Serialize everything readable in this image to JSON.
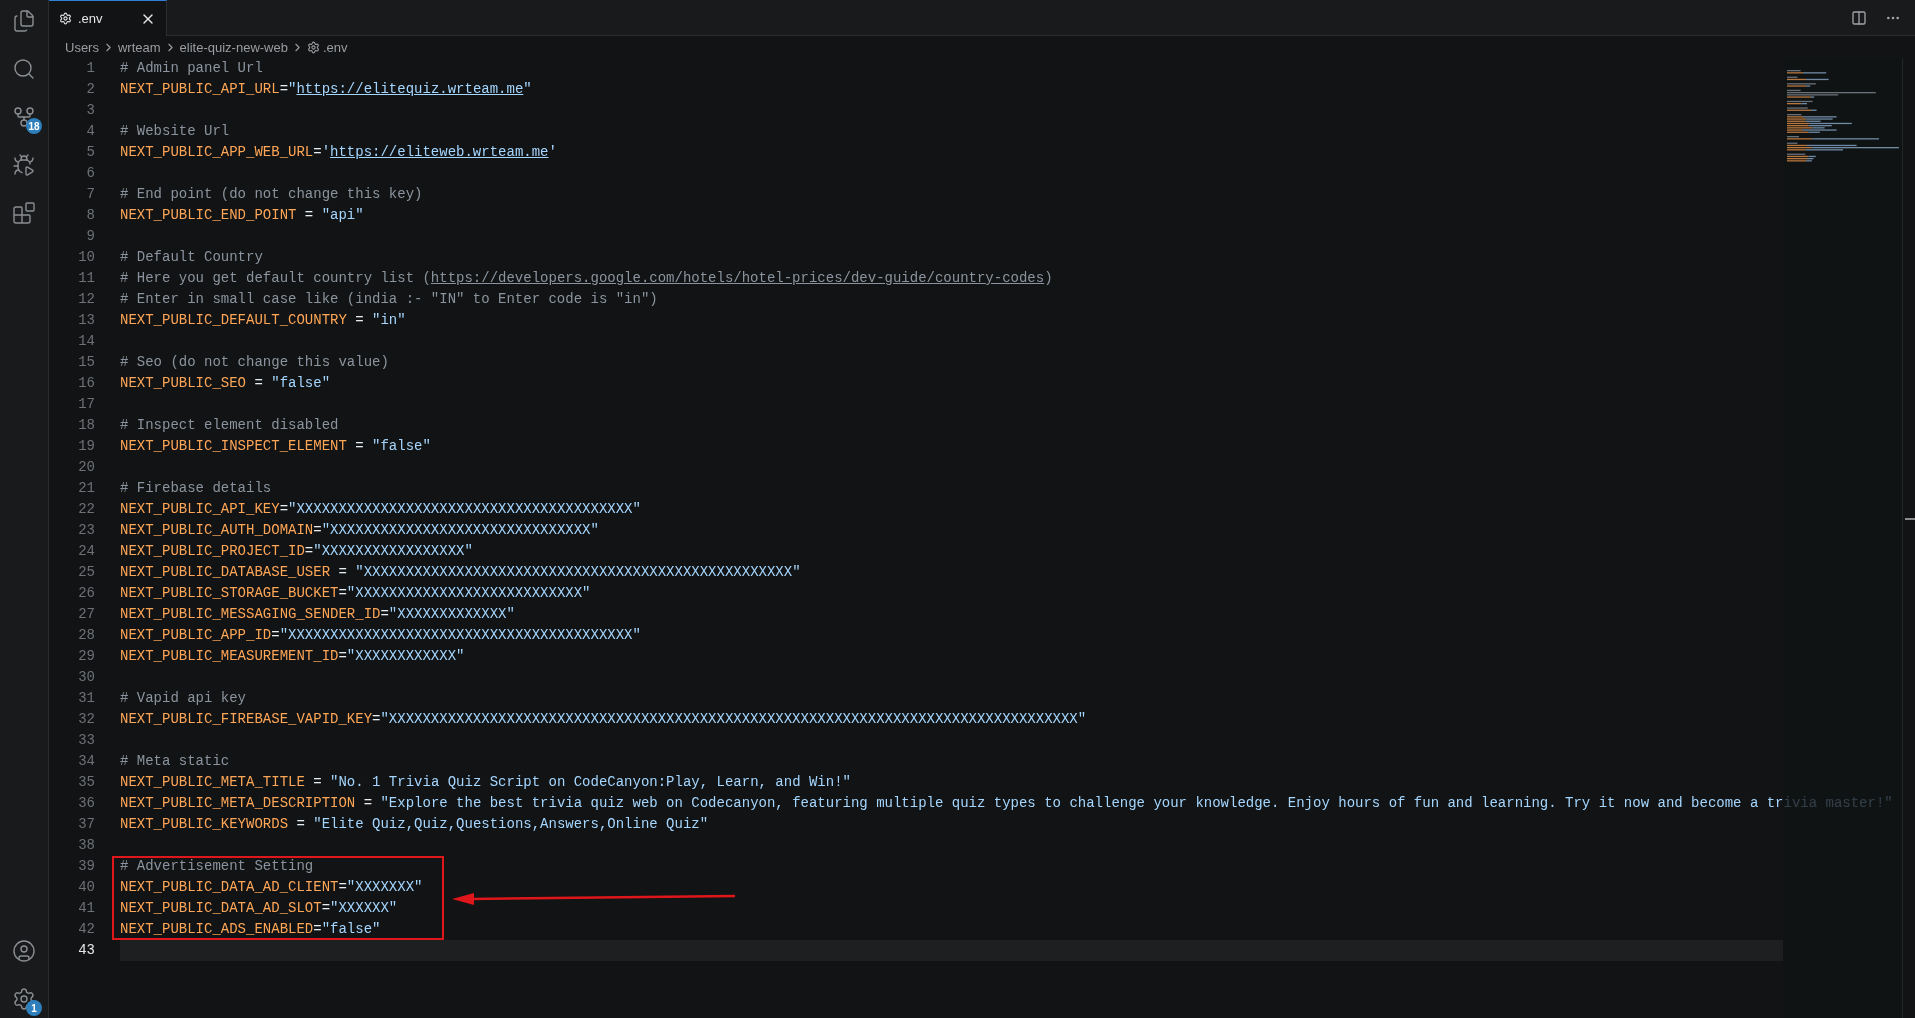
{
  "tab": {
    "label": ".env",
    "selected": true
  },
  "breadcrumbs": [
    "Users",
    "wrteam",
    "elite-quiz-new-web",
    ".env"
  ],
  "activity_bar": {
    "top": [
      {
        "kind": "explorer"
      },
      {
        "kind": "search"
      },
      {
        "kind": "source-control",
        "badge": "18"
      },
      {
        "kind": "run-debug"
      },
      {
        "kind": "extensions"
      }
    ],
    "bottom": [
      {
        "kind": "account"
      },
      {
        "kind": "settings",
        "badge": "1"
      }
    ]
  },
  "editor": {
    "lines": [
      {
        "number": "1",
        "kind": "comment",
        "text": "# Admin panel Url",
        "current": false,
        "boxed": false
      },
      {
        "number": "2",
        "kind": "assignment",
        "key": "NEXT_PUBLIC_API_URL",
        "sep": "=",
        "quote": "\"",
        "link": "https://elitequiz.wrteam.me",
        "current": false,
        "boxed": false
      },
      {
        "number": "3",
        "kind": "blank",
        "current": false,
        "boxed": false
      },
      {
        "number": "4",
        "kind": "comment",
        "text": "# Website Url",
        "current": false,
        "boxed": false
      },
      {
        "number": "5",
        "kind": "assignment",
        "key": "NEXT_PUBLIC_APP_WEB_URL",
        "sep": "=",
        "quote": "'",
        "link": "https://eliteweb.wrteam.me",
        "current": false,
        "boxed": false
      },
      {
        "number": "6",
        "kind": "blank",
        "current": false,
        "boxed": false
      },
      {
        "number": "7",
        "kind": "comment",
        "text": "# End point (do not change this key)",
        "current": false,
        "boxed": false
      },
      {
        "number": "8",
        "kind": "assignment",
        "key": "NEXT_PUBLIC_END_POINT",
        "sep": " = ",
        "value": "\"api\"",
        "current": false,
        "boxed": false
      },
      {
        "number": "9",
        "kind": "blank",
        "current": false,
        "boxed": false
      },
      {
        "number": "10",
        "kind": "comment",
        "text": "# Default Country",
        "current": false,
        "boxed": false
      },
      {
        "number": "11",
        "kind": "comment",
        "text": "# Here you get default country list (",
        "link": "https://developers.google.com/hotels/hotel-prices/dev-guide/country-codes",
        "after": ")",
        "current": false,
        "boxed": false
      },
      {
        "number": "12",
        "kind": "comment",
        "text": "# Enter in small case like (india :- \"IN\" to Enter code is \"in\")",
        "current": false,
        "boxed": false
      },
      {
        "number": "13",
        "kind": "assignment",
        "key": "NEXT_PUBLIC_DEFAULT_COUNTRY",
        "sep": " = ",
        "value": "\"in\"",
        "current": false,
        "boxed": false
      },
      {
        "number": "14",
        "kind": "blank",
        "current": false,
        "boxed": false
      },
      {
        "number": "15",
        "kind": "comment",
        "text": "# Seo (do not change this value)",
        "current": false,
        "boxed": false
      },
      {
        "number": "16",
        "kind": "assignment",
        "key": "NEXT_PUBLIC_SEO",
        "sep": " = ",
        "value": "\"false\"",
        "current": false,
        "boxed": false
      },
      {
        "number": "17",
        "kind": "blank",
        "current": false,
        "boxed": false
      },
      {
        "number": "18",
        "kind": "comment",
        "text": "# Inspect element disabled",
        "current": false,
        "boxed": false
      },
      {
        "number": "19",
        "kind": "assignment",
        "key": "NEXT_PUBLIC_INSPECT_ELEMENT",
        "sep": " = ",
        "value": "\"false\"",
        "current": false,
        "boxed": false
      },
      {
        "number": "20",
        "kind": "blank",
        "current": false,
        "boxed": false
      },
      {
        "number": "21",
        "kind": "comment",
        "text": "# Firebase details",
        "current": false,
        "boxed": false
      },
      {
        "number": "22",
        "kind": "assignment",
        "key": "NEXT_PUBLIC_API_KEY",
        "sep": "=",
        "value": "\"XXXXXXXXXXXXXXXXXXXXXXXXXXXXXXXXXXXXXXXX\"",
        "current": false,
        "boxed": false
      },
      {
        "number": "23",
        "kind": "assignment",
        "key": "NEXT_PUBLIC_AUTH_DOMAIN",
        "sep": "=",
        "value": "\"XXXXXXXXXXXXXXXXXXXXXXXXXXXXXXX\"",
        "current": false,
        "boxed": false
      },
      {
        "number": "24",
        "kind": "assignment",
        "key": "NEXT_PUBLIC_PROJECT_ID",
        "sep": "=",
        "value": "\"XXXXXXXXXXXXXXXXX\"",
        "current": false,
        "boxed": false
      },
      {
        "number": "25",
        "kind": "assignment",
        "key": "NEXT_PUBLIC_DATABASE_USER",
        "sep": " = ",
        "value": "\"XXXXXXXXXXXXXXXXXXXXXXXXXXXXXXXXXXXXXXXXXXXXXXXXXXX\"",
        "current": false,
        "boxed": false
      },
      {
        "number": "26",
        "kind": "assignment",
        "key": "NEXT_PUBLIC_STORAGE_BUCKET",
        "sep": "=",
        "value": "\"XXXXXXXXXXXXXXXXXXXXXXXXXXX\"",
        "current": false,
        "boxed": false
      },
      {
        "number": "27",
        "kind": "assignment",
        "key": "NEXT_PUBLIC_MESSAGING_SENDER_ID",
        "sep": "=",
        "value": "\"XXXXXXXXXXXXX\"",
        "current": false,
        "boxed": false
      },
      {
        "number": "28",
        "kind": "assignment",
        "key": "NEXT_PUBLIC_APP_ID",
        "sep": "=",
        "value": "\"XXXXXXXXXXXXXXXXXXXXXXXXXXXXXXXXXXXXXXXXX\"",
        "current": false,
        "boxed": false
      },
      {
        "number": "29",
        "kind": "assignment",
        "key": "NEXT_PUBLIC_MEASUREMENT_ID",
        "sep": "=",
        "value": "\"XXXXXXXXXXXX\"",
        "current": false,
        "boxed": false
      },
      {
        "number": "30",
        "kind": "blank",
        "current": false,
        "boxed": false
      },
      {
        "number": "31",
        "kind": "comment",
        "text": "# Vapid api key",
        "current": false,
        "boxed": false
      },
      {
        "number": "32",
        "kind": "assignment",
        "key": "NEXT_PUBLIC_FIREBASE_VAPID_KEY",
        "sep": "=",
        "value": "\"XXXXXXXXXXXXXXXXXXXXXXXXXXXXXXXXXXXXXXXXXXXXXXXXXXXXXXXXXXXXXXXXXXXXXXXXXXXXXXXXXX\"",
        "current": false,
        "boxed": false
      },
      {
        "number": "33",
        "kind": "blank",
        "current": false,
        "boxed": false
      },
      {
        "number": "34",
        "kind": "comment",
        "text": "# Meta static",
        "current": false,
        "boxed": false
      },
      {
        "number": "35",
        "kind": "assignment",
        "key": "NEXT_PUBLIC_META_TITLE",
        "sep": " = ",
        "value": "\"No. 1 Trivia Quiz Script on CodeCanyon:Play, Learn, and Win!\"",
        "current": false,
        "boxed": false
      },
      {
        "number": "36",
        "kind": "assignment",
        "key": "NEXT_PUBLIC_META_DESCRIPTION",
        "sep": " = ",
        "value": "\"Explore the best trivia quiz web on Codecanyon, featuring multiple quiz types to challenge your knowledge. Enjoy hours of fun and learning. Try it now and become a trivia master!\"",
        "current": false,
        "boxed": false
      },
      {
        "number": "37",
        "kind": "assignment",
        "key": "NEXT_PUBLIC_KEYWORDS",
        "sep": " = ",
        "value": "\"Elite Quiz,Quiz,Questions,Answers,Online Quiz\"",
        "current": false,
        "boxed": false
      },
      {
        "number": "38",
        "kind": "blank",
        "current": false,
        "boxed": false
      },
      {
        "number": "39",
        "kind": "comment",
        "text": "# Advertisement Setting",
        "current": false,
        "boxed": true
      },
      {
        "number": "40",
        "kind": "assignment",
        "key": "NEXT_PUBLIC_DATA_AD_CLIENT",
        "sep": "=",
        "value": "\"XXXXXXX\"",
        "current": false,
        "boxed": true
      },
      {
        "number": "41",
        "kind": "assignment",
        "key": "NEXT_PUBLIC_DATA_AD_SLOT",
        "sep": "=",
        "value": "\"XXXXXX\"",
        "current": false,
        "boxed": true
      },
      {
        "number": "42",
        "kind": "assignment",
        "key": "NEXT_PUBLIC_ADS_ENABLED",
        "sep": "=",
        "value": "\"false\"",
        "current": false,
        "boxed": true
      },
      {
        "number": "43",
        "kind": "blank",
        "current": true,
        "boxed": false
      }
    ]
  }
}
